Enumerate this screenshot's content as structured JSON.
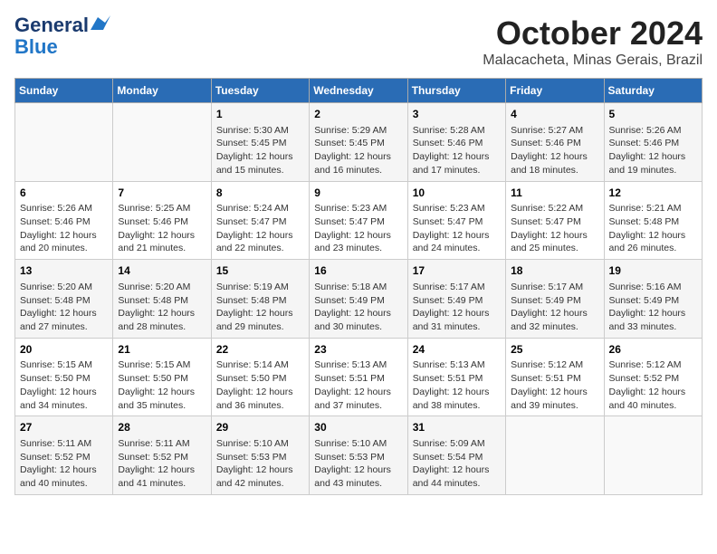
{
  "header": {
    "logo_line1": "General",
    "logo_line2": "Blue",
    "title": "October 2024",
    "subtitle": "Malacacheta, Minas Gerais, Brazil"
  },
  "weekdays": [
    "Sunday",
    "Monday",
    "Tuesday",
    "Wednesday",
    "Thursday",
    "Friday",
    "Saturday"
  ],
  "weeks": [
    [
      {
        "day": "",
        "sunrise": "",
        "sunset": "",
        "daylight": ""
      },
      {
        "day": "",
        "sunrise": "",
        "sunset": "",
        "daylight": ""
      },
      {
        "day": "1",
        "sunrise": "Sunrise: 5:30 AM",
        "sunset": "Sunset: 5:45 PM",
        "daylight": "Daylight: 12 hours and 15 minutes."
      },
      {
        "day": "2",
        "sunrise": "Sunrise: 5:29 AM",
        "sunset": "Sunset: 5:45 PM",
        "daylight": "Daylight: 12 hours and 16 minutes."
      },
      {
        "day": "3",
        "sunrise": "Sunrise: 5:28 AM",
        "sunset": "Sunset: 5:46 PM",
        "daylight": "Daylight: 12 hours and 17 minutes."
      },
      {
        "day": "4",
        "sunrise": "Sunrise: 5:27 AM",
        "sunset": "Sunset: 5:46 PM",
        "daylight": "Daylight: 12 hours and 18 minutes."
      },
      {
        "day": "5",
        "sunrise": "Sunrise: 5:26 AM",
        "sunset": "Sunset: 5:46 PM",
        "daylight": "Daylight: 12 hours and 19 minutes."
      }
    ],
    [
      {
        "day": "6",
        "sunrise": "Sunrise: 5:26 AM",
        "sunset": "Sunset: 5:46 PM",
        "daylight": "Daylight: 12 hours and 20 minutes."
      },
      {
        "day": "7",
        "sunrise": "Sunrise: 5:25 AM",
        "sunset": "Sunset: 5:46 PM",
        "daylight": "Daylight: 12 hours and 21 minutes."
      },
      {
        "day": "8",
        "sunrise": "Sunrise: 5:24 AM",
        "sunset": "Sunset: 5:47 PM",
        "daylight": "Daylight: 12 hours and 22 minutes."
      },
      {
        "day": "9",
        "sunrise": "Sunrise: 5:23 AM",
        "sunset": "Sunset: 5:47 PM",
        "daylight": "Daylight: 12 hours and 23 minutes."
      },
      {
        "day": "10",
        "sunrise": "Sunrise: 5:23 AM",
        "sunset": "Sunset: 5:47 PM",
        "daylight": "Daylight: 12 hours and 24 minutes."
      },
      {
        "day": "11",
        "sunrise": "Sunrise: 5:22 AM",
        "sunset": "Sunset: 5:47 PM",
        "daylight": "Daylight: 12 hours and 25 minutes."
      },
      {
        "day": "12",
        "sunrise": "Sunrise: 5:21 AM",
        "sunset": "Sunset: 5:48 PM",
        "daylight": "Daylight: 12 hours and 26 minutes."
      }
    ],
    [
      {
        "day": "13",
        "sunrise": "Sunrise: 5:20 AM",
        "sunset": "Sunset: 5:48 PM",
        "daylight": "Daylight: 12 hours and 27 minutes."
      },
      {
        "day": "14",
        "sunrise": "Sunrise: 5:20 AM",
        "sunset": "Sunset: 5:48 PM",
        "daylight": "Daylight: 12 hours and 28 minutes."
      },
      {
        "day": "15",
        "sunrise": "Sunrise: 5:19 AM",
        "sunset": "Sunset: 5:48 PM",
        "daylight": "Daylight: 12 hours and 29 minutes."
      },
      {
        "day": "16",
        "sunrise": "Sunrise: 5:18 AM",
        "sunset": "Sunset: 5:49 PM",
        "daylight": "Daylight: 12 hours and 30 minutes."
      },
      {
        "day": "17",
        "sunrise": "Sunrise: 5:17 AM",
        "sunset": "Sunset: 5:49 PM",
        "daylight": "Daylight: 12 hours and 31 minutes."
      },
      {
        "day": "18",
        "sunrise": "Sunrise: 5:17 AM",
        "sunset": "Sunset: 5:49 PM",
        "daylight": "Daylight: 12 hours and 32 minutes."
      },
      {
        "day": "19",
        "sunrise": "Sunrise: 5:16 AM",
        "sunset": "Sunset: 5:49 PM",
        "daylight": "Daylight: 12 hours and 33 minutes."
      }
    ],
    [
      {
        "day": "20",
        "sunrise": "Sunrise: 5:15 AM",
        "sunset": "Sunset: 5:50 PM",
        "daylight": "Daylight: 12 hours and 34 minutes."
      },
      {
        "day": "21",
        "sunrise": "Sunrise: 5:15 AM",
        "sunset": "Sunset: 5:50 PM",
        "daylight": "Daylight: 12 hours and 35 minutes."
      },
      {
        "day": "22",
        "sunrise": "Sunrise: 5:14 AM",
        "sunset": "Sunset: 5:50 PM",
        "daylight": "Daylight: 12 hours and 36 minutes."
      },
      {
        "day": "23",
        "sunrise": "Sunrise: 5:13 AM",
        "sunset": "Sunset: 5:51 PM",
        "daylight": "Daylight: 12 hours and 37 minutes."
      },
      {
        "day": "24",
        "sunrise": "Sunrise: 5:13 AM",
        "sunset": "Sunset: 5:51 PM",
        "daylight": "Daylight: 12 hours and 38 minutes."
      },
      {
        "day": "25",
        "sunrise": "Sunrise: 5:12 AM",
        "sunset": "Sunset: 5:51 PM",
        "daylight": "Daylight: 12 hours and 39 minutes."
      },
      {
        "day": "26",
        "sunrise": "Sunrise: 5:12 AM",
        "sunset": "Sunset: 5:52 PM",
        "daylight": "Daylight: 12 hours and 40 minutes."
      }
    ],
    [
      {
        "day": "27",
        "sunrise": "Sunrise: 5:11 AM",
        "sunset": "Sunset: 5:52 PM",
        "daylight": "Daylight: 12 hours and 40 minutes."
      },
      {
        "day": "28",
        "sunrise": "Sunrise: 5:11 AM",
        "sunset": "Sunset: 5:52 PM",
        "daylight": "Daylight: 12 hours and 41 minutes."
      },
      {
        "day": "29",
        "sunrise": "Sunrise: 5:10 AM",
        "sunset": "Sunset: 5:53 PM",
        "daylight": "Daylight: 12 hours and 42 minutes."
      },
      {
        "day": "30",
        "sunrise": "Sunrise: 5:10 AM",
        "sunset": "Sunset: 5:53 PM",
        "daylight": "Daylight: 12 hours and 43 minutes."
      },
      {
        "day": "31",
        "sunrise": "Sunrise: 5:09 AM",
        "sunset": "Sunset: 5:54 PM",
        "daylight": "Daylight: 12 hours and 44 minutes."
      },
      {
        "day": "",
        "sunrise": "",
        "sunset": "",
        "daylight": ""
      },
      {
        "day": "",
        "sunrise": "",
        "sunset": "",
        "daylight": ""
      }
    ]
  ]
}
